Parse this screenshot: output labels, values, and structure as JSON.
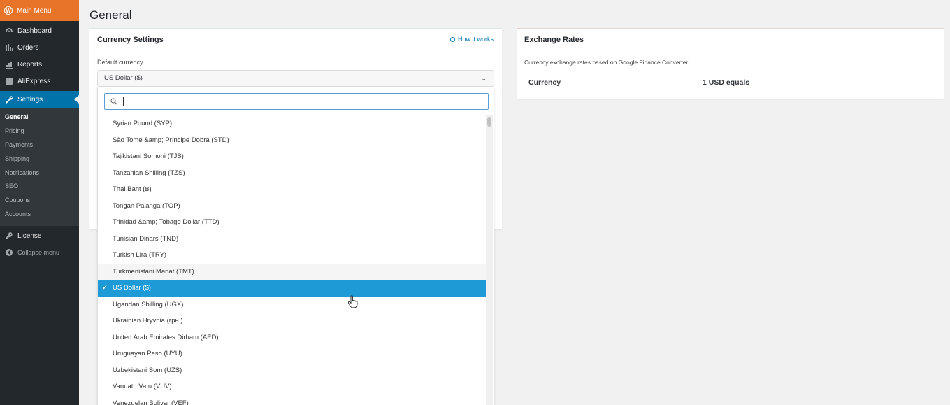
{
  "sidebar": {
    "main_menu": "Main Menu",
    "items": [
      {
        "label": "Dashboard",
        "icon": "dashboard-icon"
      },
      {
        "label": "Orders",
        "icon": "orders-icon"
      },
      {
        "label": "Reports",
        "icon": "reports-icon"
      },
      {
        "label": "AliExpress",
        "icon": "aliexpress-icon"
      }
    ],
    "settings": {
      "label": "Settings",
      "icon": "wrench-icon"
    },
    "submenu": [
      "General",
      "Pricing",
      "Payments",
      "Shipping",
      "Notifications",
      "SEO",
      "Coupons",
      "Accounts"
    ],
    "license": "License",
    "collapse": "Collapse menu"
  },
  "page": {
    "title": "General"
  },
  "currency_settings": {
    "title": "Currency Settings",
    "how_it_works": "How it works",
    "default_label": "Default currency",
    "selected": "US Dollar ($)"
  },
  "dropdown": {
    "search_value": "",
    "options": [
      "Syrian Pound (SYP)",
      "São Tomé &amp; Príncipe Dobra (STD)",
      "Tajikistani Somoni (TJS)",
      "Tanzanian Shilling (TZS)",
      "Thai Baht (฿)",
      "Tongan Pa'anga (TOP)",
      "Trinidad &amp; Tobago Dollar (TTD)",
      "Tunisian Dinars (TND)",
      "Turkish Lira (TRY)",
      "Turkmenistani Manat (TMT)",
      "US Dollar ($)",
      "Ugandan Shilling (UGX)",
      "Ukrainian Hryvnia (грн.)",
      "United Arab Emirates Dirham (AED)",
      "Uruguayan Peso (UYU)",
      "Uzbekistani Som (UZS)",
      "Vanuatu Vatu (VUV)",
      "Venezuelan Bolivar (VEF)"
    ],
    "selected_index": 10,
    "hover_index": 9
  },
  "exchange_rates": {
    "title": "Exchange Rates",
    "description": "Currency exchange rates based on Google Finance Converter",
    "col_currency": "Currency",
    "col_equals": "1 USD equals"
  },
  "colors": {
    "sidebar_bg": "#23282d",
    "main_menu_bg": "#e8742a",
    "active_blue": "#0073aa",
    "selected_option": "#1e9ad6"
  }
}
